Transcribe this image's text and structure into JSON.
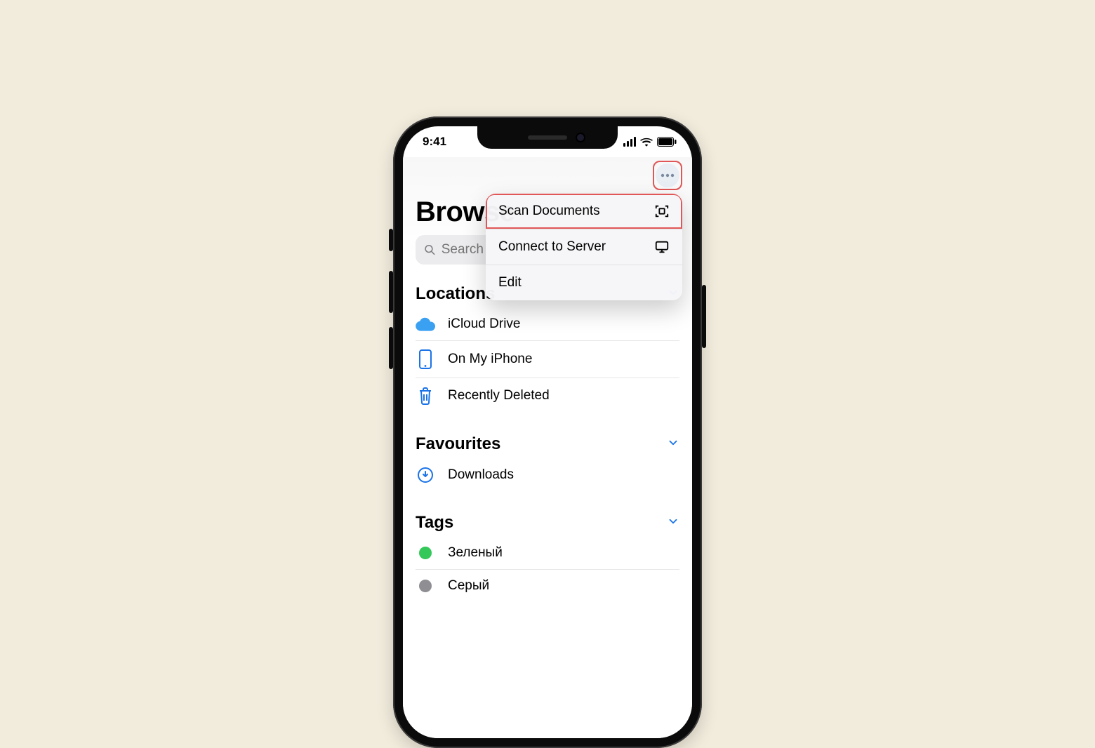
{
  "status": {
    "time": "9:41"
  },
  "header": {
    "title": "Browse"
  },
  "search": {
    "placeholder": "Search"
  },
  "menu": {
    "items": [
      {
        "label": "Scan Documents",
        "icon": "scan-icon",
        "highlighted": true
      },
      {
        "label": "Connect to Server",
        "icon": "server-icon"
      },
      {
        "label": "Edit"
      }
    ]
  },
  "sections": {
    "locations": {
      "title": "Locations",
      "items": [
        {
          "label": "iCloud Drive",
          "icon": "icloud-icon"
        },
        {
          "label": "On My iPhone",
          "icon": "iphone-icon"
        },
        {
          "label": "Recently Deleted",
          "icon": "trash-icon"
        }
      ]
    },
    "favourites": {
      "title": "Favourites",
      "items": [
        {
          "label": "Downloads",
          "icon": "download-icon"
        }
      ]
    },
    "tags": {
      "title": "Tags",
      "items": [
        {
          "label": "Зеленый",
          "color": "#34c759"
        },
        {
          "label": "Серый",
          "color": "#8e8e93"
        }
      ]
    }
  }
}
